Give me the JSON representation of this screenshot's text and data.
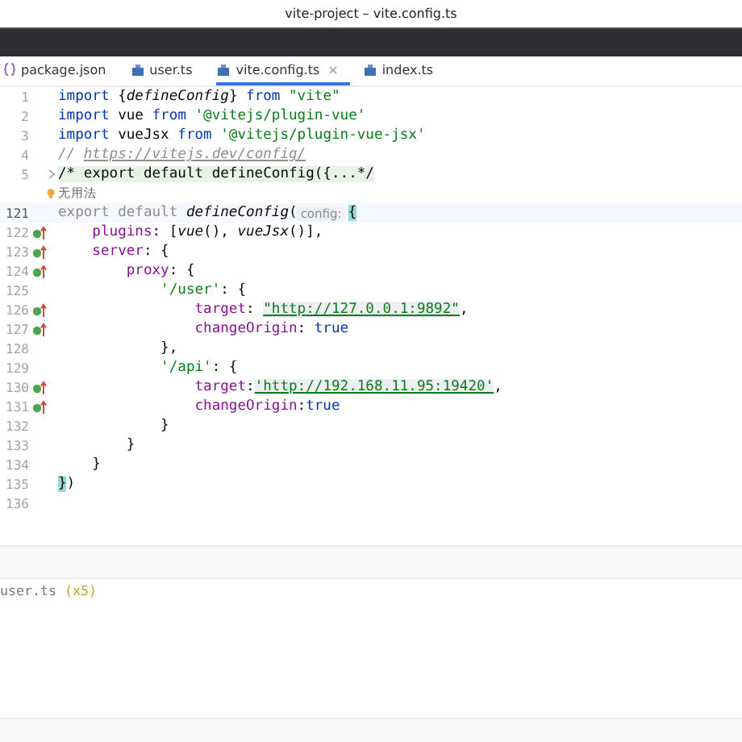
{
  "window": {
    "title": "vite-project – vite.config.ts"
  },
  "tabs": [
    {
      "label": "package.json",
      "kind": "json",
      "selected": false
    },
    {
      "label": "user.ts",
      "kind": "typescript",
      "selected": false
    },
    {
      "label": "vite.config.ts",
      "kind": "typescript",
      "selected": true,
      "close": "×"
    },
    {
      "label": "index.ts",
      "kind": "typescript",
      "selected": false
    }
  ],
  "editor": {
    "lines": [
      {
        "kind": "code",
        "number": "1",
        "marker": false,
        "current": false,
        "folded": false,
        "tokens": [
          {
            "kind": "keyword",
            "text": "import "
          },
          {
            "kind": "plain",
            "text": "{"
          },
          {
            "kind": "function",
            "text": "defineConfig"
          },
          {
            "kind": "plain",
            "text": "} "
          },
          {
            "kind": "keyword",
            "text": "from "
          },
          {
            "kind": "string",
            "text": "\"vite\""
          }
        ]
      },
      {
        "kind": "code",
        "number": "2",
        "marker": false,
        "current": false,
        "folded": false,
        "tokens": [
          {
            "kind": "keyword",
            "text": "import "
          },
          {
            "kind": "plain",
            "text": "vue "
          },
          {
            "kind": "keyword",
            "text": "from "
          },
          {
            "kind": "string",
            "text": "'@vitejs/plugin-vue'"
          }
        ]
      },
      {
        "kind": "code",
        "number": "3",
        "marker": false,
        "current": false,
        "folded": false,
        "tokens": [
          {
            "kind": "keyword",
            "text": "import "
          },
          {
            "kind": "plain",
            "text": "vueJsx "
          },
          {
            "kind": "keyword",
            "text": "from "
          },
          {
            "kind": "string",
            "text": "'@vitejs/plugin-vue-jsx'"
          }
        ]
      },
      {
        "kind": "code",
        "number": "4",
        "marker": false,
        "current": false,
        "folded": false,
        "tokens": [
          {
            "kind": "comment",
            "text": "// "
          },
          {
            "kind": "link",
            "text": "https://vitejs.dev/config/"
          }
        ]
      },
      {
        "kind": "code",
        "number": "5",
        "marker": false,
        "current": false,
        "folded": true,
        "tokens": [
          {
            "kind": "fold",
            "text": "/* export default defineConfig({...*/"
          }
        ]
      },
      {
        "kind": "hint",
        "text": "无用法"
      },
      {
        "kind": "code",
        "number": "121",
        "marker": false,
        "current": true,
        "folded": false,
        "tokens": [
          {
            "kind": "muted",
            "text": "export default "
          },
          {
            "kind": "function",
            "text": "defineConfig"
          },
          {
            "kind": "plain",
            "text": "("
          },
          {
            "kind": "inlay",
            "text": "config:"
          },
          {
            "kind": "match",
            "text": "{"
          }
        ]
      },
      {
        "kind": "code",
        "number": "122",
        "marker": true,
        "current": false,
        "folded": false,
        "tokens": [
          {
            "kind": "property",
            "text": "    plugins"
          },
          {
            "kind": "plain",
            "text": ": ["
          },
          {
            "kind": "function",
            "text": "vue"
          },
          {
            "kind": "plain",
            "text": "(), "
          },
          {
            "kind": "function",
            "text": "vueJsx"
          },
          {
            "kind": "plain",
            "text": "()],"
          }
        ]
      },
      {
        "kind": "code",
        "number": "123",
        "marker": true,
        "current": false,
        "folded": false,
        "tokens": [
          {
            "kind": "property",
            "text": "    server"
          },
          {
            "kind": "plain",
            "text": ": {"
          }
        ]
      },
      {
        "kind": "code",
        "number": "124",
        "marker": true,
        "current": false,
        "folded": false,
        "tokens": [
          {
            "kind": "property",
            "text": "        proxy"
          },
          {
            "kind": "plain",
            "text": ": {"
          }
        ]
      },
      {
        "kind": "code",
        "number": "125",
        "marker": false,
        "current": false,
        "folded": false,
        "tokens": [
          {
            "kind": "string",
            "text": "            '/user'"
          },
          {
            "kind": "plain",
            "text": ": {"
          }
        ]
      },
      {
        "kind": "code",
        "number": "126",
        "marker": true,
        "current": false,
        "folded": false,
        "tokens": [
          {
            "kind": "property",
            "text": "                target"
          },
          {
            "kind": "plain",
            "text": ": "
          },
          {
            "kind": "url",
            "text": "\"http://127.0.0.1:9892\""
          },
          {
            "kind": "plain",
            "text": ","
          }
        ]
      },
      {
        "kind": "code",
        "number": "127",
        "marker": true,
        "current": false,
        "folded": false,
        "tokens": [
          {
            "kind": "property",
            "text": "                changeOrigin"
          },
          {
            "kind": "plain",
            "text": ": "
          },
          {
            "kind": "keyword",
            "text": "true"
          }
        ]
      },
      {
        "kind": "code",
        "number": "128",
        "marker": false,
        "current": false,
        "folded": false,
        "tokens": [
          {
            "kind": "plain",
            "text": "            },"
          }
        ]
      },
      {
        "kind": "code",
        "number": "129",
        "marker": false,
        "current": false,
        "folded": false,
        "tokens": [
          {
            "kind": "string",
            "text": "            '/api'"
          },
          {
            "kind": "plain",
            "text": ": {"
          }
        ]
      },
      {
        "kind": "code",
        "number": "130",
        "marker": true,
        "current": false,
        "folded": false,
        "tokens": [
          {
            "kind": "property",
            "text": "                target"
          },
          {
            "kind": "plain",
            "text": ":"
          },
          {
            "kind": "url",
            "text": "'http://192.168.11.95:19420'"
          },
          {
            "kind": "plain",
            "text": ","
          }
        ]
      },
      {
        "kind": "code",
        "number": "131",
        "marker": true,
        "current": false,
        "folded": false,
        "tokens": [
          {
            "kind": "property",
            "text": "                changeOrigin"
          },
          {
            "kind": "plain",
            "text": ":"
          },
          {
            "kind": "keyword",
            "text": "true"
          }
        ]
      },
      {
        "kind": "code",
        "number": "132",
        "marker": false,
        "current": false,
        "folded": false,
        "tokens": [
          {
            "kind": "plain",
            "text": "            }"
          }
        ]
      },
      {
        "kind": "code",
        "number": "133",
        "marker": false,
        "current": false,
        "folded": false,
        "tokens": [
          {
            "kind": "plain",
            "text": "        }"
          }
        ]
      },
      {
        "kind": "code",
        "number": "134",
        "marker": false,
        "current": false,
        "folded": false,
        "tokens": [
          {
            "kind": "plain",
            "text": "    }"
          }
        ]
      },
      {
        "kind": "code",
        "number": "135",
        "marker": false,
        "current": false,
        "folded": false,
        "tokens": [
          {
            "kind": "match",
            "text": "}"
          },
          {
            "kind": "plain",
            "text": ")"
          }
        ]
      },
      {
        "kind": "code",
        "number": "136",
        "marker": false,
        "current": false,
        "folded": false
      }
    ]
  },
  "results": {
    "file": "user.ts",
    "count": "(x5)"
  }
}
